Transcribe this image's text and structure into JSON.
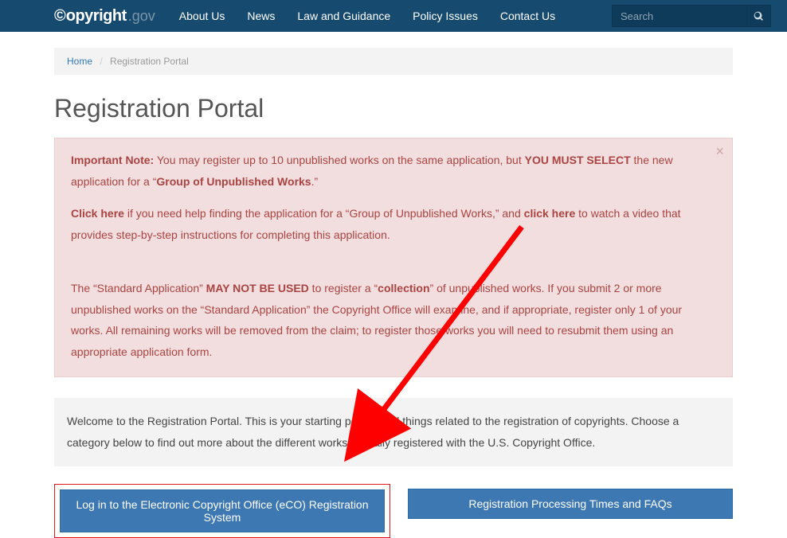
{
  "header": {
    "logo_main": "opyright",
    "logo_suffix": ".gov",
    "nav": [
      "About Us",
      "News",
      "Law and Guidance",
      "Policy Issues",
      "Contact Us"
    ],
    "search_placeholder": "Search"
  },
  "breadcrumb": {
    "home": "Home",
    "current": "Registration Portal"
  },
  "page_title": "Registration Portal",
  "alert": {
    "p1_a": "Important Note:",
    "p1_b": " You may register up to 10 unpublished works on the same application, but ",
    "p1_c": "YOU MUST SELECT",
    "p1_d": " the new application for a “",
    "p1_e": "Group of Unpublished Works",
    "p1_f": ".”",
    "p2_a": "Click here",
    "p2_b": " if you need help finding the application for a “Group of Unpublished Works,” and ",
    "p2_c": "click here",
    "p2_d": " to watch a video that provides step-by-step instructions for completing this application.",
    "p3_a": "The “Standard Application” ",
    "p3_b": "MAY NOT BE USED",
    "p3_c": " to register a “",
    "p3_d": "collection",
    "p3_e": "” of unpublished works. If you submit 2 or more unpublished works on the “Standard Application” the Copyright Office will examine, and if appropriate, register only 1 of your works. All remaining works will be removed from the claim; to register those works you will need to resubmit them using an appropriate application form."
  },
  "welcome": "Welcome to the Registration Portal. This is your starting point for all things related to the registration of copyrights. Choose a category below to find out more about the different works typically registered with the U.S. Copyright Office.",
  "buttons": {
    "login": "Log in to the Electronic Copyright Office (eCO) Registration System",
    "faqs": "Registration Processing Times and FAQs"
  }
}
